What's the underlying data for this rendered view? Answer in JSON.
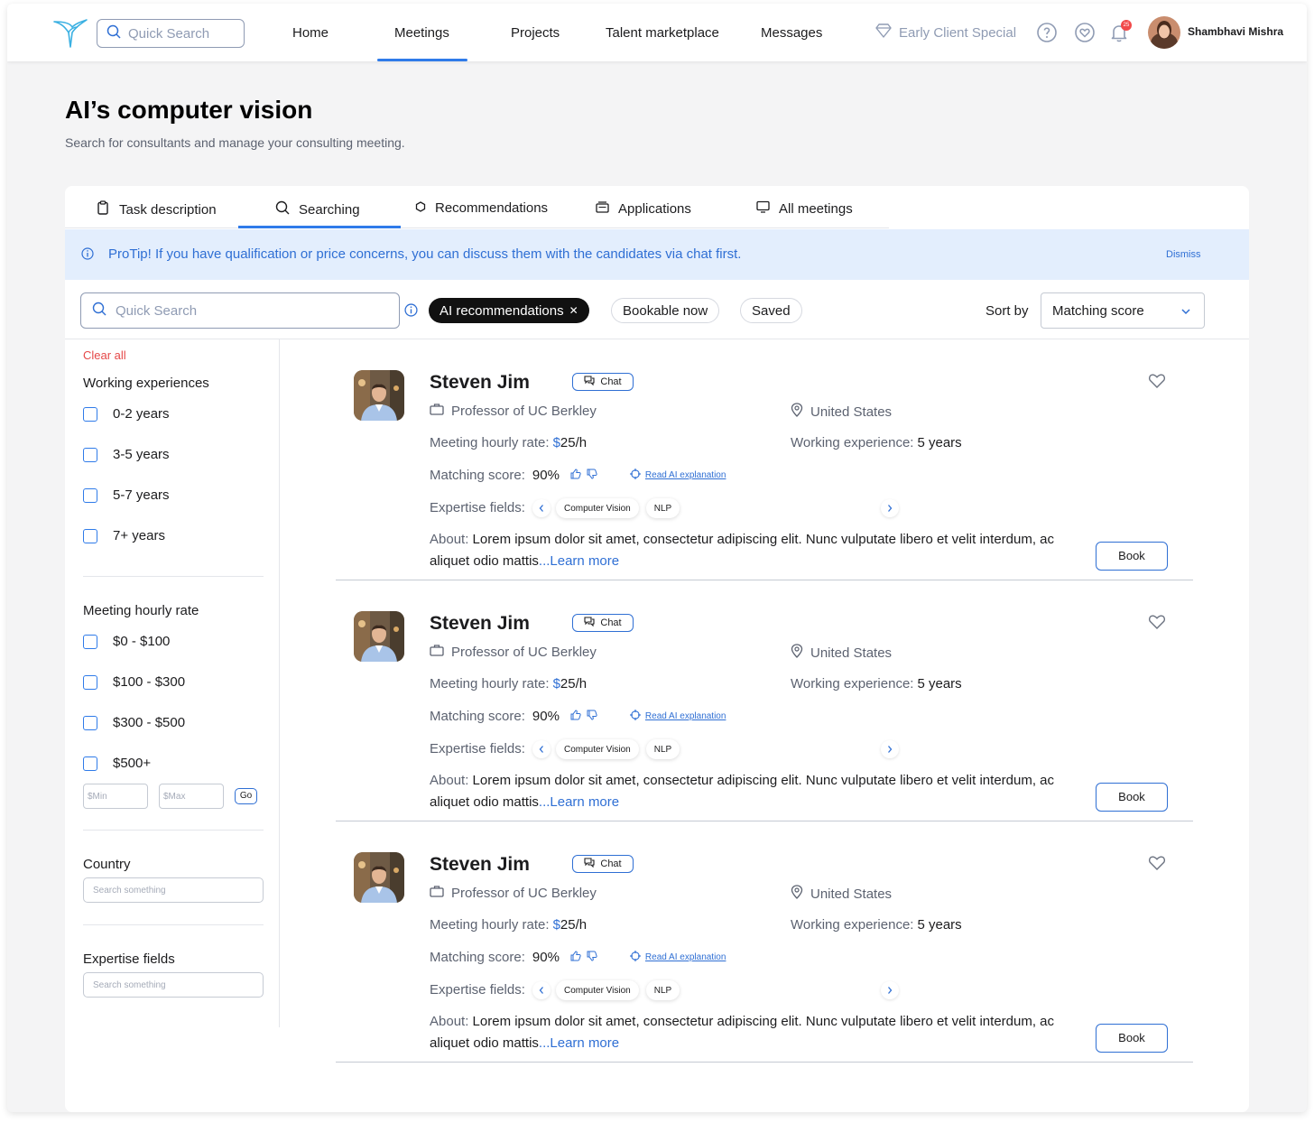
{
  "header": {
    "search_placeholder": "Quick Search",
    "nav": [
      "Home",
      "Meetings",
      "Projects",
      "Talent marketplace",
      "Messages"
    ],
    "active_nav": "Meetings",
    "promo": "Early Client Special",
    "notification_count": "25",
    "user_name": "Shambhavi Mishra"
  },
  "page": {
    "title": "AI’s computer vision",
    "subtitle": "Search for consultants and manage your consulting meeting."
  },
  "tabs": [
    {
      "label": "Task description",
      "icon": "clipboard-icon"
    },
    {
      "label": "Searching",
      "icon": "search-icon"
    },
    {
      "label": "Recommendations",
      "icon": "hexagon-icon"
    },
    {
      "label": "Applications",
      "icon": "stack-icon"
    },
    {
      "label": "All meetings",
      "icon": "monitor-icon"
    }
  ],
  "active_tab": "Searching",
  "protip": {
    "lead": "ProTip!",
    "text": " If you have qualification or price concerns, you can discuss them with the candidates via chat first.",
    "dismiss": "Dismiss"
  },
  "filters": {
    "search_placeholder": "Quick Search",
    "chips": {
      "ai": "AI recommendations",
      "bookable": "Bookable now",
      "saved": "Saved"
    },
    "sort_label": "Sort by",
    "sort_value": "Matching score"
  },
  "sidebar": {
    "clear_all": "Clear all",
    "experience_title": "Working experiences",
    "experience_options": [
      "0-2 years",
      "3-5 years",
      "5-7 years",
      "7+ years"
    ],
    "rate_title": "Meeting hourly rate",
    "rate_options": [
      "$0 - $100",
      "$100 - $300",
      "$300 - $500",
      "$500+"
    ],
    "min_placeholder": "$Min",
    "max_placeholder": "$Max",
    "go": "Go",
    "country_title": "Country",
    "country_placeholder": "Search something",
    "expertise_title": "Expertise fields",
    "expertise_placeholder": "Search something"
  },
  "results": [
    {
      "name": "Steven Jim",
      "chat": "Chat",
      "title": "Professor of UC Berkley",
      "location": "United States",
      "rate_label": "Meeting hourly rate:",
      "rate_currency": "$",
      "rate_value": "25/h",
      "exp_label": "Working experience:",
      "exp_value": "5 years",
      "score_label": "Matching score:",
      "score_value": "90%",
      "ai_link": "Read AI explanation",
      "expertise_label": "Expertise fields:",
      "tags": [
        "Computer Vision",
        "NLP"
      ],
      "about_label": "About:",
      "about_text": " Lorem ipsum dolor sit amet, consectetur adipiscing elit. Nunc vulputate libero et velit interdum, ac aliquet odio mattis",
      "learn_more": "...Learn more",
      "book": "Book"
    },
    {
      "name": "Steven Jim",
      "chat": "Chat",
      "title": "Professor of UC Berkley",
      "location": "United States",
      "rate_label": "Meeting hourly rate:",
      "rate_currency": "$",
      "rate_value": "25/h",
      "exp_label": "Working experience:",
      "exp_value": "5 years",
      "score_label": "Matching score:",
      "score_value": "90%",
      "ai_link": "Read AI explanation",
      "expertise_label": "Expertise fields:",
      "tags": [
        "Computer Vision",
        "NLP"
      ],
      "about_label": "About:",
      "about_text": " Lorem ipsum dolor sit amet, consectetur adipiscing elit. Nunc vulputate libero et velit interdum, ac aliquet odio mattis",
      "learn_more": "...Learn more",
      "book": "Book"
    },
    {
      "name": "Steven Jim",
      "chat": "Chat",
      "title": "Professor of UC Berkley",
      "location": "United States",
      "rate_label": "Meeting hourly rate:",
      "rate_currency": "$",
      "rate_value": "25/h",
      "exp_label": "Working experience:",
      "exp_value": "5 years",
      "score_label": "Matching score:",
      "score_value": "90%",
      "ai_link": "Read AI explanation",
      "expertise_label": "Expertise fields:",
      "tags": [
        "Computer Vision",
        "NLP"
      ],
      "about_label": "About:",
      "about_text": " Lorem ipsum dolor sit amet, consectetur adipiscing elit. Nunc vulputate libero et velit interdum, ac aliquet odio mattis",
      "learn_more": "...Learn more",
      "book": "Book"
    }
  ],
  "colors": {
    "accent": "#2f7be9",
    "link": "#2f6fd4",
    "protip_bg": "#e3eefd",
    "danger": "#e54848",
    "badge": "#f14a4a"
  }
}
